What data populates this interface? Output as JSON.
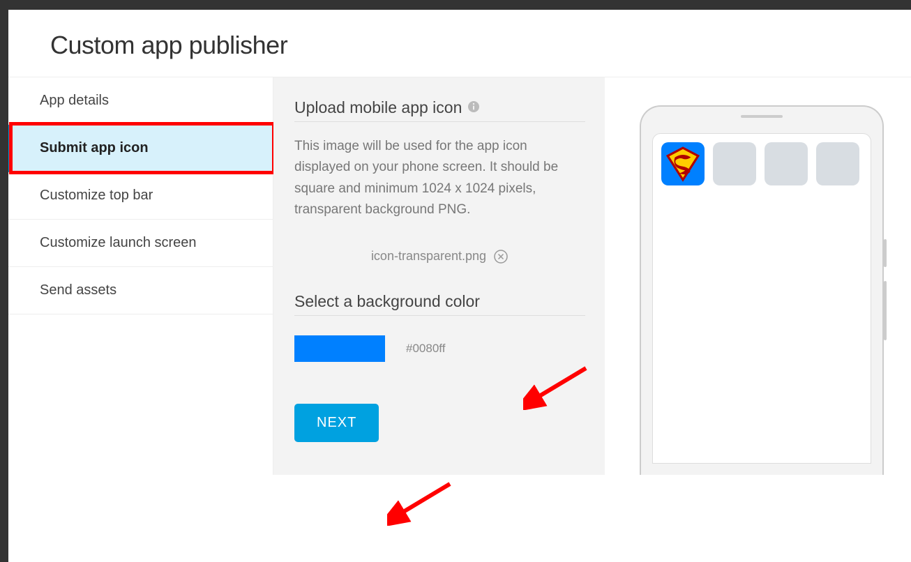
{
  "header": {
    "title": "Custom app publisher"
  },
  "sidebar": {
    "items": [
      "App details",
      "Submit app icon",
      "Customize top bar",
      "Customize launch screen",
      "Send assets"
    ],
    "active_index": 1
  },
  "upload": {
    "title": "Upload mobile app icon",
    "description": "This image will be used for the app icon displayed on your phone screen. It should be square and minimum 1024 x 1024 pixels, transparent background PNG.",
    "file_name": "icon-transparent.png"
  },
  "background": {
    "title": "Select a background color",
    "hex": "#0080ff"
  },
  "actions": {
    "next_label": "NEXT"
  },
  "preview": {
    "icon_tile_name": "superman-logo-icon"
  },
  "annotations": {
    "arrows": 2,
    "red_box_on_active_sidebar": true
  }
}
